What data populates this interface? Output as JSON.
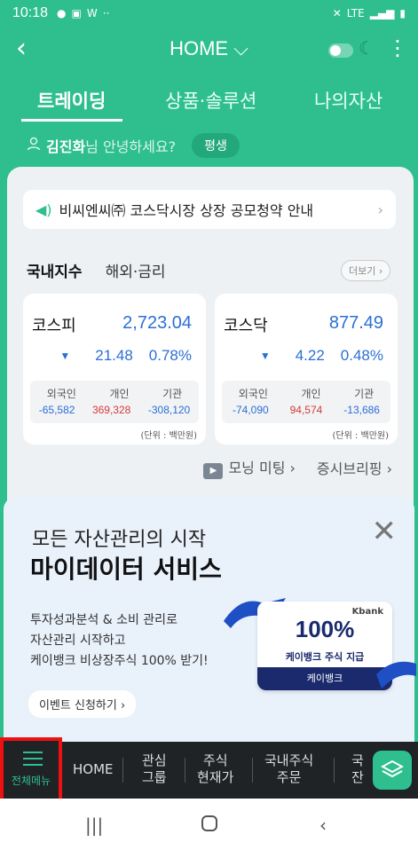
{
  "status": {
    "time": "10:18",
    "notif_w": "W",
    "more": "··",
    "net": "LTE"
  },
  "appbar": {
    "title": "HOME ⌵"
  },
  "tabs": [
    "트레이딩",
    "상품·솔루션",
    "나의자산"
  ],
  "greeting": {
    "name": "김진화",
    "text": "님 안녕하세요?",
    "badge": "평생"
  },
  "notice": {
    "text": "비씨엔씨㈜ 코스닥시장 상장 공모청약 안내"
  },
  "index_tabs": {
    "domestic": "국내지수",
    "global": "해외·금리",
    "more": "더보기 ›"
  },
  "indices": [
    {
      "name": "코스피",
      "value": "2,723.04",
      "change": "21.48",
      "pct": "0.78%",
      "investors": {
        "labels": [
          "외국인",
          "개인",
          "기관"
        ],
        "values": [
          "-65,582",
          "369,328",
          "-308,120"
        ]
      },
      "unit": "(단위 : 백만원)"
    },
    {
      "name": "코스닥",
      "value": "877.49",
      "change": "4.22",
      "pct": "0.48%",
      "investors": {
        "labels": [
          "외국인",
          "개인",
          "기관"
        ],
        "values": [
          "-74,090",
          "94,574",
          "-13,686"
        ]
      },
      "unit": "(단위 : 백만원)"
    }
  ],
  "links": {
    "morning": "모닝 미팅 ›",
    "briefing": "증시브리핑 ›"
  },
  "banner": {
    "sub": "모든 자산관리의 시작",
    "main": "마이데이터 서비스",
    "desc1": "투자성과분석 & 소비 관리로",
    "desc2": "자산관리 시작하고",
    "desc3": "케이뱅크 비상장주식 100% 받기!",
    "event": "이벤트 신청하기 ›",
    "ticket_brand": "Kbank",
    "ticket_pct": "100%",
    "ticket_label": "케이뱅크 주식 지급",
    "ticket_foot": "케이뱅크"
  },
  "bottom_nav": {
    "all_menu": "전체메뉴",
    "home": "HOME",
    "watch": [
      "관심",
      "그룹"
    ],
    "price": [
      "주식",
      "현재가"
    ],
    "order": [
      "국내주식",
      "주문"
    ],
    "cut": [
      "국",
      "잔"
    ]
  },
  "colors": {
    "primary": "#2fbf8f",
    "down": "#2a6fd6",
    "up": "#d63a3a"
  }
}
